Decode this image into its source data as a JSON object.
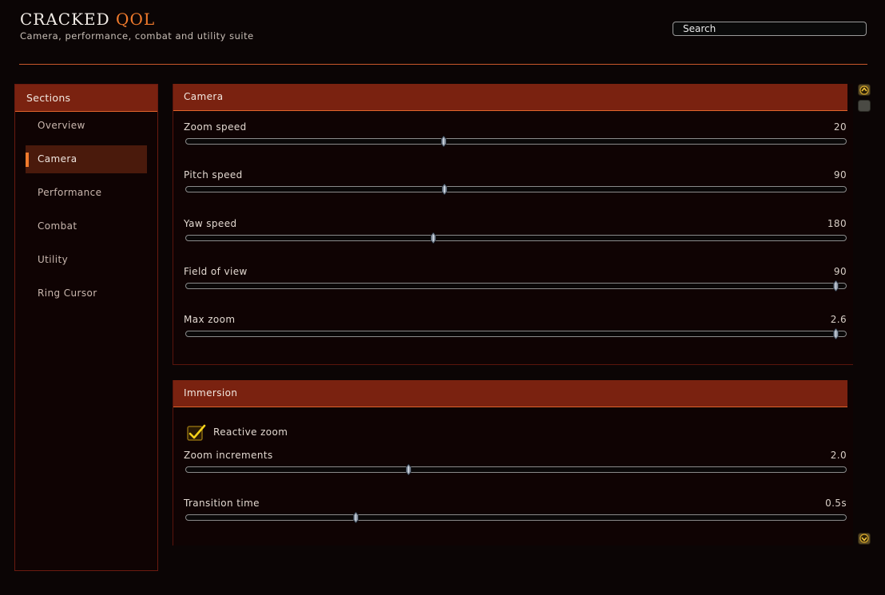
{
  "header": {
    "title_main": "CRACKED",
    "title_accent": "QOL",
    "subtitle": "Camera, performance, combat and utility suite"
  },
  "search": {
    "placeholder": "Search",
    "value": ""
  },
  "sidebar": {
    "header": "Sections",
    "items": [
      {
        "label": "Overview",
        "active": false
      },
      {
        "label": "Camera",
        "active": true
      },
      {
        "label": "Performance",
        "active": false
      },
      {
        "label": "Combat",
        "active": false
      },
      {
        "label": "Utility",
        "active": false
      },
      {
        "label": "Ring Cursor",
        "active": false
      }
    ]
  },
  "panels": {
    "camera": {
      "title": "Camera",
      "sliders": [
        {
          "label": "Zoom speed",
          "value": "20",
          "fraction": 0.39
        },
        {
          "label": "Pitch speed",
          "value": "90",
          "fraction": 0.391
        },
        {
          "label": "Yaw speed",
          "value": "180",
          "fraction": 0.374
        },
        {
          "label": "Field of view",
          "value": "90",
          "fraction": 0.984
        },
        {
          "label": "Max zoom",
          "value": "2.6",
          "fraction": 0.984
        }
      ]
    },
    "immersion": {
      "title": "Immersion",
      "checkbox": {
        "label": "Reactive zoom",
        "checked": true
      },
      "sliders": [
        {
          "label": "Zoom increments",
          "value": "2.0",
          "fraction": 0.337
        },
        {
          "label": "Transition time",
          "value": "0.5s",
          "fraction": 0.257
        }
      ]
    }
  },
  "colors": {
    "accent": "#f07a2c",
    "header_bg": "#7a2210",
    "panel_bg": "#0f0303",
    "page_bg": "#0b0505"
  },
  "icons": {
    "scroll_top": "scroll-to-top-icon",
    "scroll_up": "scroll-up-icon",
    "scroll_down": "scroll-to-bottom-icon"
  }
}
